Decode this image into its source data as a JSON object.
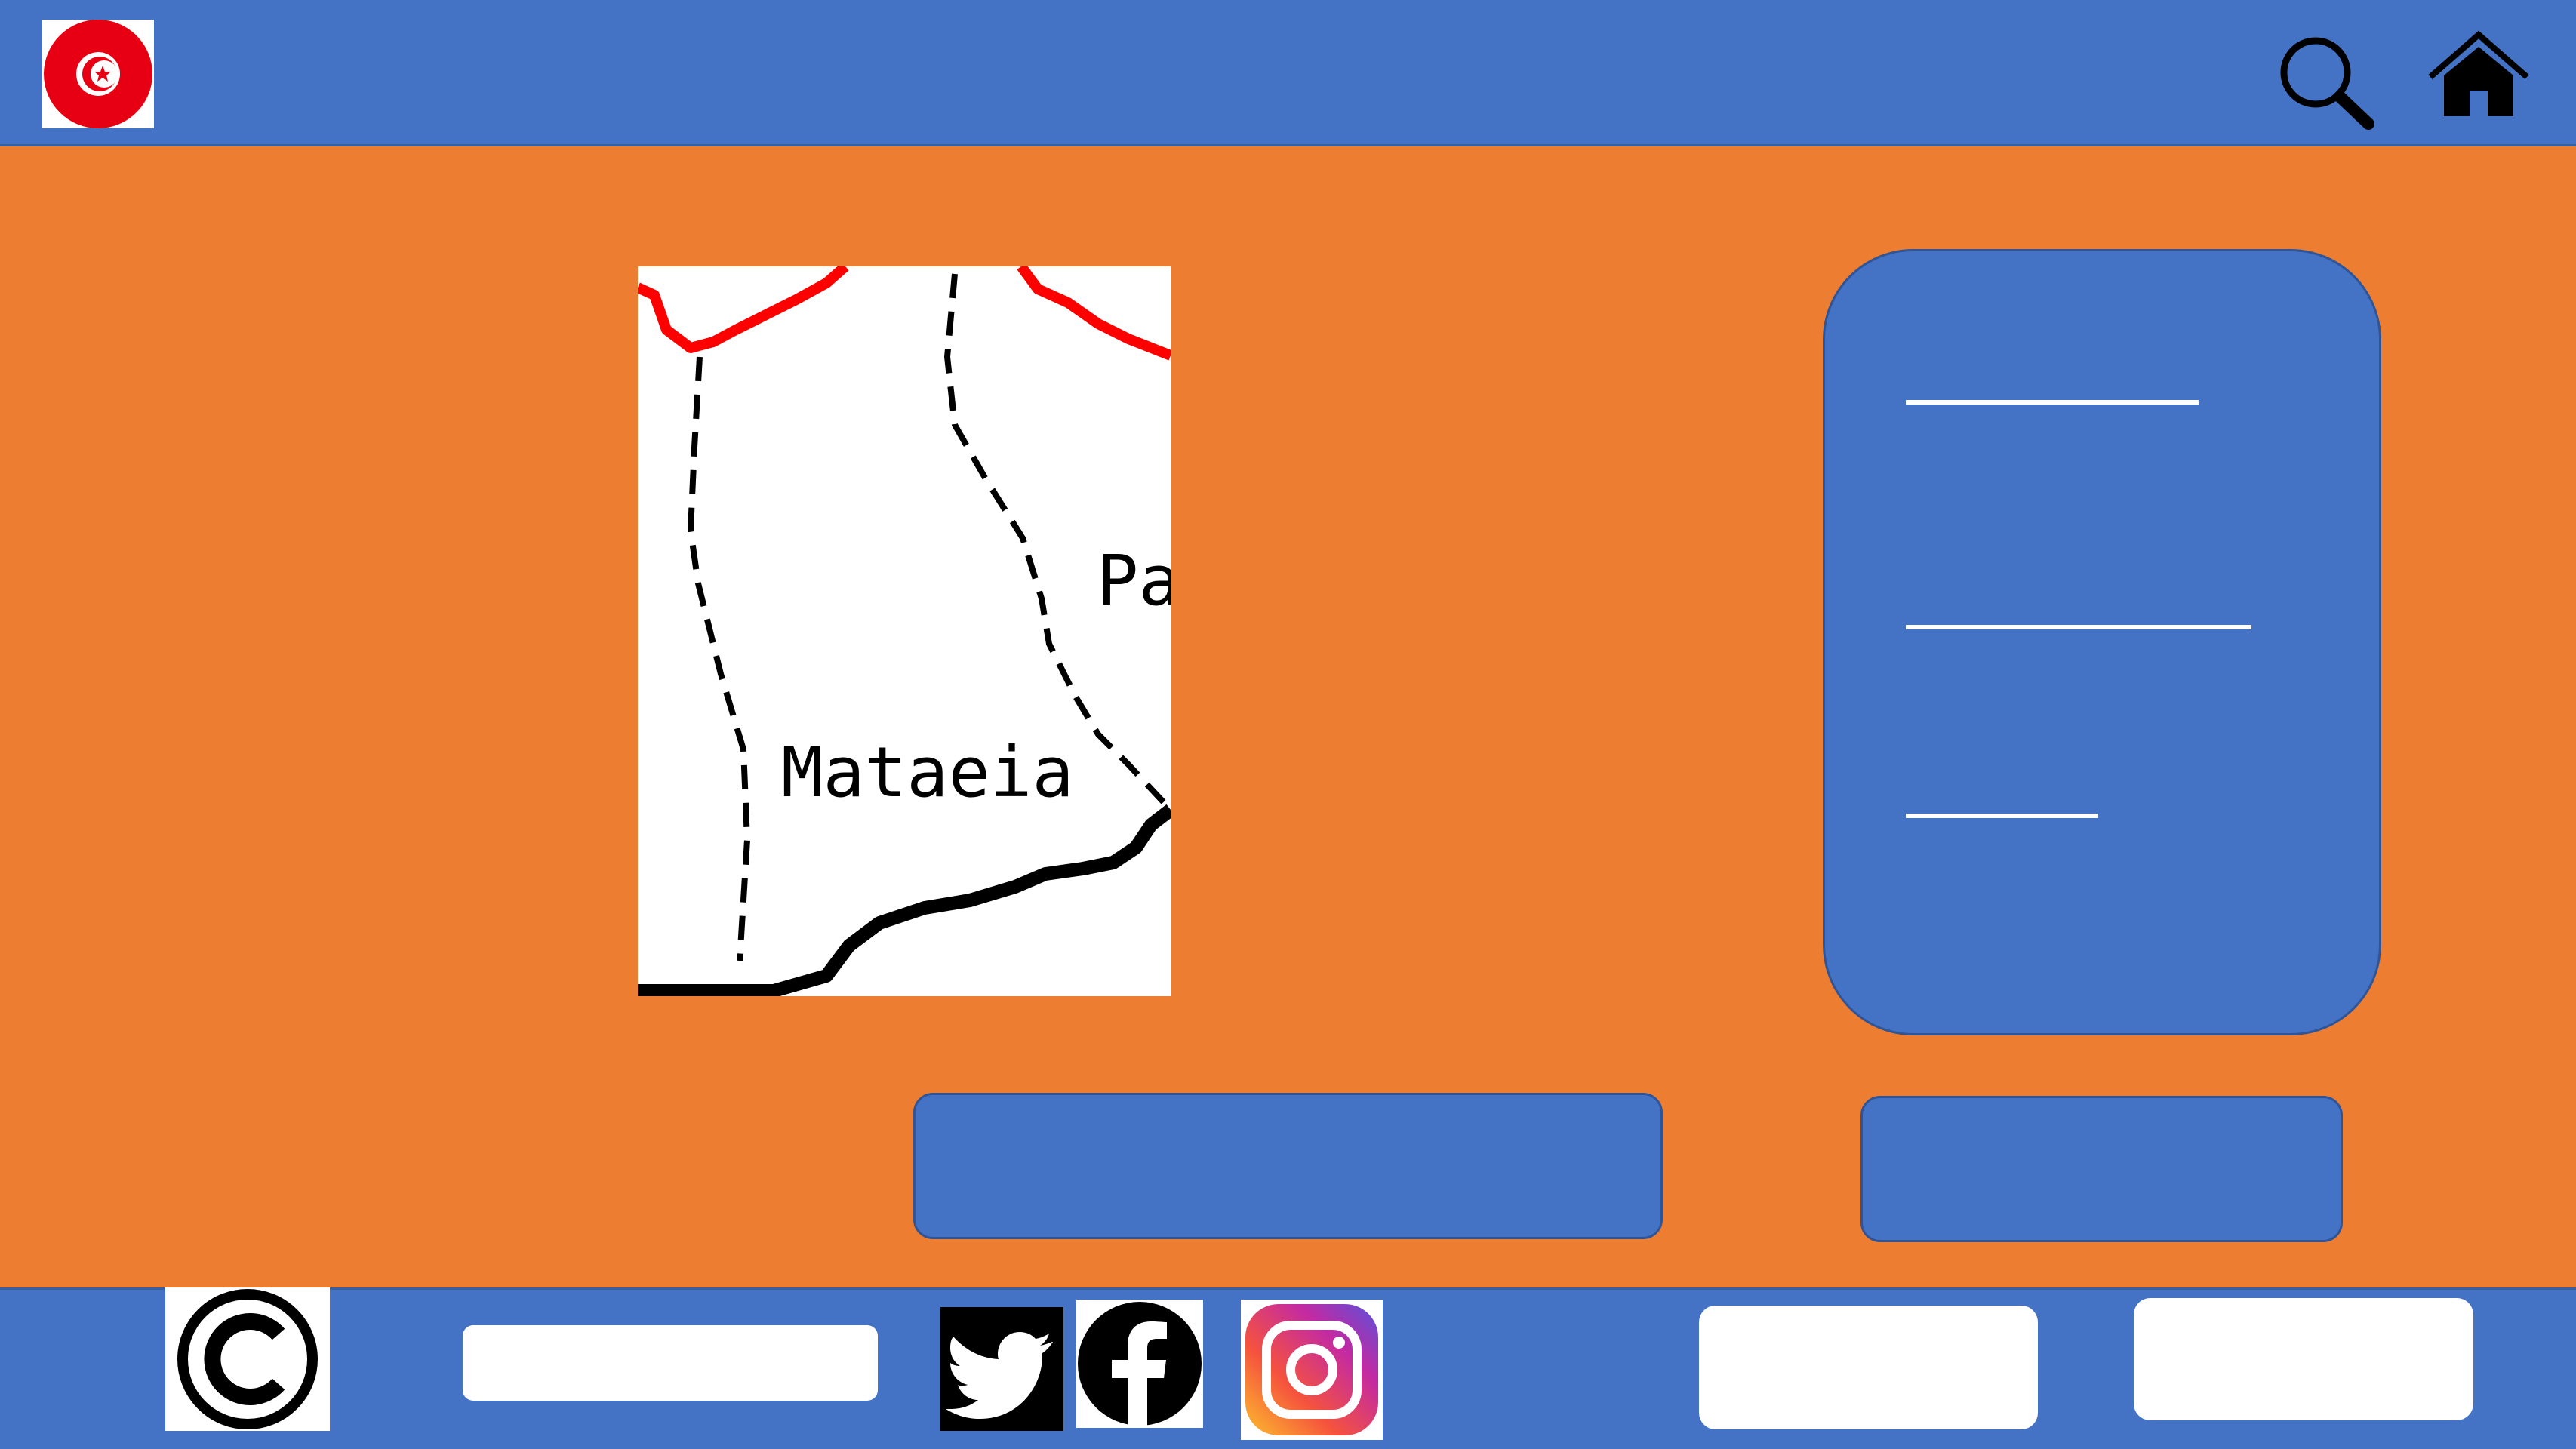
{
  "colors": {
    "header_bg": "#4472c4",
    "main_bg": "#ed7d31",
    "footer_bg": "#4472c4",
    "panel_bg": "#4472c4",
    "flag_red": "#e70013",
    "map_red_border": "#ff0000"
  },
  "header": {
    "logo_icon": "tunisia-flag-icon",
    "search_icon": "search-icon",
    "home_icon": "home-icon"
  },
  "map": {
    "label_main": "Mataeia",
    "label_cut": "Pa"
  },
  "info_panel": {
    "line_count_shown": 3
  },
  "footer": {
    "copyright_icon": "copyright-icon",
    "social": [
      "twitter-icon",
      "facebook-icon",
      "instagram-icon"
    ]
  }
}
